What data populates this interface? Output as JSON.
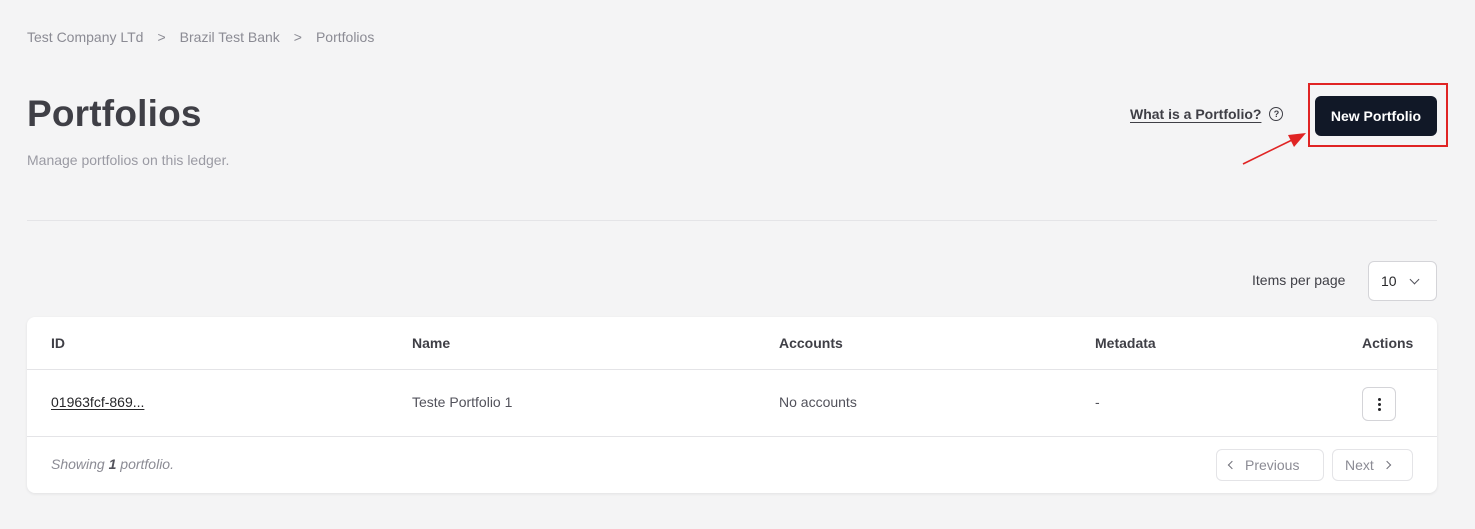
{
  "breadcrumb": {
    "items": [
      "Test Company LTd",
      "Brazil Test Bank",
      "Portfolios"
    ],
    "separator": ">"
  },
  "header": {
    "title": "Portfolios",
    "subtitle": "Manage portfolios on this ledger.",
    "help_link": "What is a Portfolio?",
    "help_icon": "?",
    "new_button": "New Portfolio"
  },
  "pagination_control": {
    "items_per_page_label": "Items per page",
    "items_per_page_value": "10"
  },
  "table": {
    "columns": [
      "ID",
      "Name",
      "Accounts",
      "Metadata",
      "Actions"
    ],
    "rows": [
      {
        "id": "01963fcf-869...",
        "name": "Teste Portfolio 1",
        "accounts": "No accounts",
        "metadata": "-"
      }
    ]
  },
  "footer": {
    "showing_prefix": "Showing",
    "showing_count": "1",
    "showing_suffix": "portfolio.",
    "previous_label": "Previous",
    "next_label": "Next"
  },
  "colors": {
    "primary_button": "#111827",
    "annotation": "#e02424",
    "background": "#f4f4f5"
  }
}
